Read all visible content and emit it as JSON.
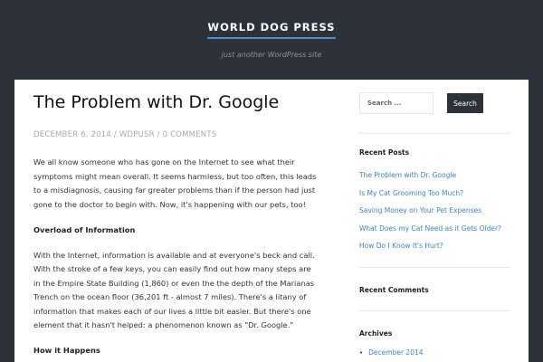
{
  "site": {
    "title": "WORLD DOG PRESS",
    "description": "just another WordPress site"
  },
  "post": {
    "title": "The Problem with Dr. Google",
    "date": "DECEMBER 6, 2014",
    "author": "WDPUSR",
    "comments": "0 COMMENTS",
    "separator": " / ",
    "paragraph1": "We all know someone who has gone on the Internet to see what their symptoms might mean overall. It seems harmless, but too often, this leads to a misdiagnosis, causing far greater problems than if the person had just gone to the doctor to begin with. Now, it's happening with our pets, too!",
    "heading1": "Overload of Information",
    "paragraph2": "With the Internet, information is available and at everyone's beck and call. With the stroke of a few keys, you can easily find out how many steps are in the Empire State Building (1,860) or even the the depth of the Marianas Trench on the ocean floor (36,201 ft - almost 7 miles). There's a litany of information that makes each of our lives a little bit easier. But there's one element that it hasn't helped: a phenomenon known as \"Dr. Google.\"",
    "heading2": "How it Happens"
  },
  "sidebar": {
    "search_placeholder": "Search ...",
    "search_button": "Search",
    "recent_posts_title": "Recent Posts",
    "recent_posts": [
      "The Problem with Dr. Google",
      "Is My Cat Grooming Too Much?",
      "Saving Money on Your Pet Expenses",
      "What Does my Cat Need as it Gets Older?",
      "How Do I Know It's Hurt?"
    ],
    "recent_comments_title": "Recent Comments",
    "archives_title": "Archives",
    "archives": [
      "December 2014"
    ]
  },
  "colors": {
    "header_bg": "#2c313a",
    "accent": "#4a90c9",
    "link": "#3a85c5"
  }
}
